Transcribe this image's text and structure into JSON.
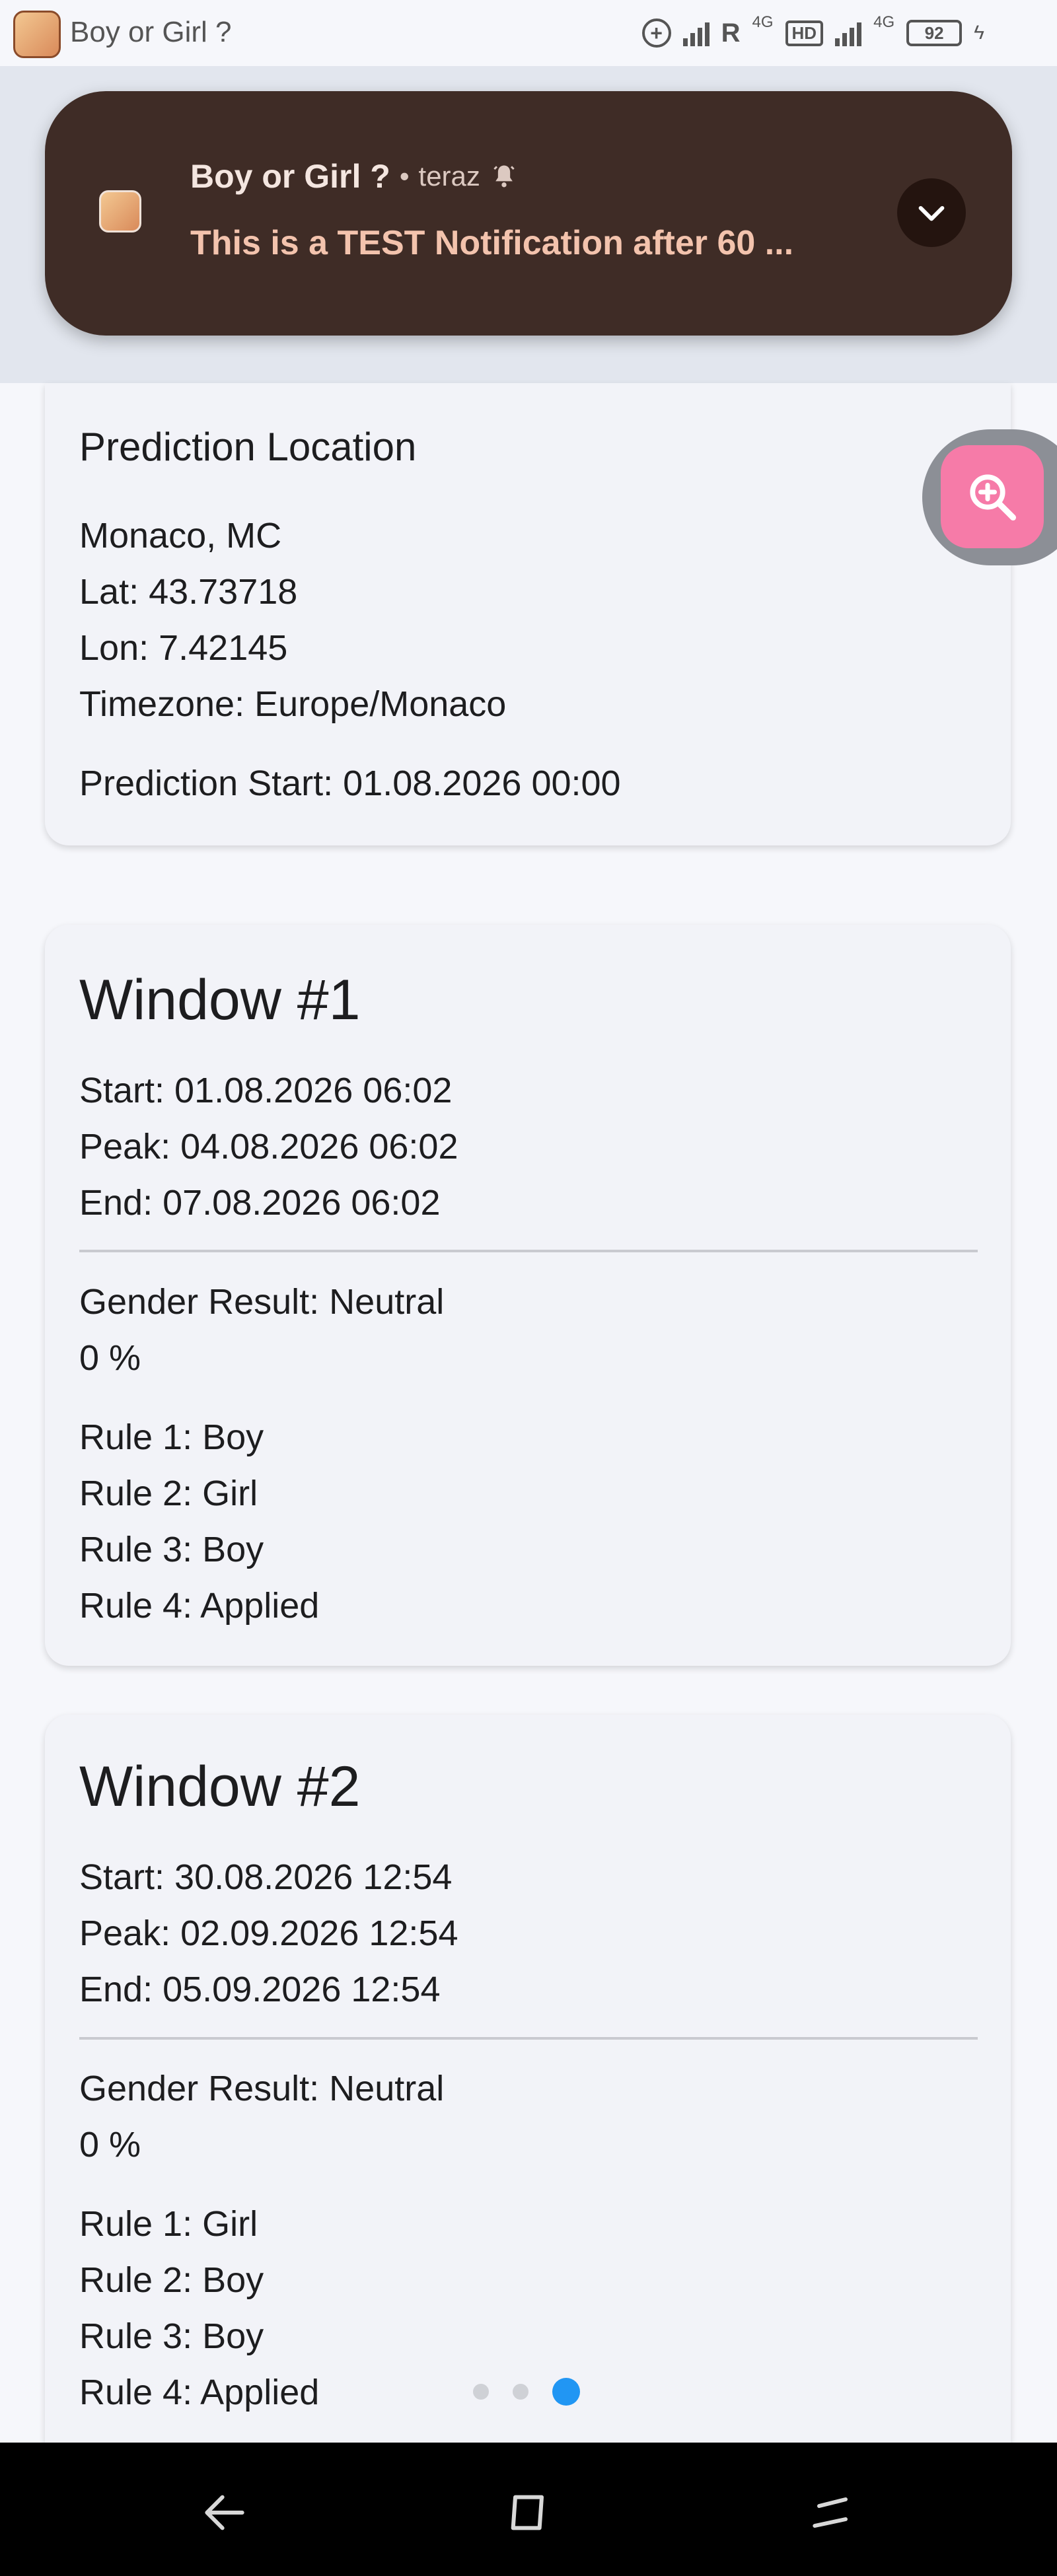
{
  "status_bar": {
    "app_title": "Boy or Girl ?",
    "network_label": "R",
    "network_type_1": "4G",
    "hd_label": "HD",
    "network_type_2": "4G",
    "battery_level": "92",
    "icons": [
      "data-saver-icon",
      "signal-icon",
      "signal-icon",
      "battery-icon",
      "charging-icon"
    ]
  },
  "notification": {
    "app_name": "Boy or Girl ?",
    "separator": "•",
    "time": "teraz",
    "message": "This is a TEST Notification after 60 ...",
    "icons": [
      "app-icon",
      "bell-icon",
      "chevron-down-icon"
    ]
  },
  "location_card": {
    "title": "Prediction Location",
    "place": "Monaco, MC",
    "lat": "Lat: 43.73718",
    "lon": "Lon: 7.42145",
    "timezone": "Timezone: Europe/Monaco",
    "prediction_start": "Prediction Start: 01.08.2026 00:00"
  },
  "windows": [
    {
      "title": "Window #1",
      "start": "Start: 01.08.2026 06:02",
      "peak": "Peak: 04.08.2026 06:02",
      "end": "End: 07.08.2026 06:02",
      "gender_result": "Gender Result: Neutral",
      "percent": "0 %",
      "rules": [
        "Rule 1: Boy",
        "Rule 2: Girl",
        "Rule 3: Boy",
        "Rule 4: Applied"
      ]
    },
    {
      "title": "Window #2",
      "start": "Start: 30.08.2026 12:54",
      "peak": "Peak: 02.09.2026 12:54",
      "end": "End: 05.09.2026 12:54",
      "gender_result": "Gender Result: Neutral",
      "percent": "0 %",
      "rules": [
        "Rule 1: Girl",
        "Rule 2: Boy",
        "Rule 3: Boy",
        "Rule 4: Applied"
      ]
    }
  ],
  "page_indicator": {
    "count": 3,
    "active_index": 2
  },
  "fab": {
    "icon": "zoom-in-icon",
    "color": "#f67ba8"
  },
  "nav_bar": {
    "icons": [
      "back-icon",
      "home-icon",
      "recents-icon"
    ]
  },
  "colors": {
    "accent": "#2196f3",
    "notification_bg": "#3f2c26",
    "notification_text": "#f3c3ad"
  }
}
